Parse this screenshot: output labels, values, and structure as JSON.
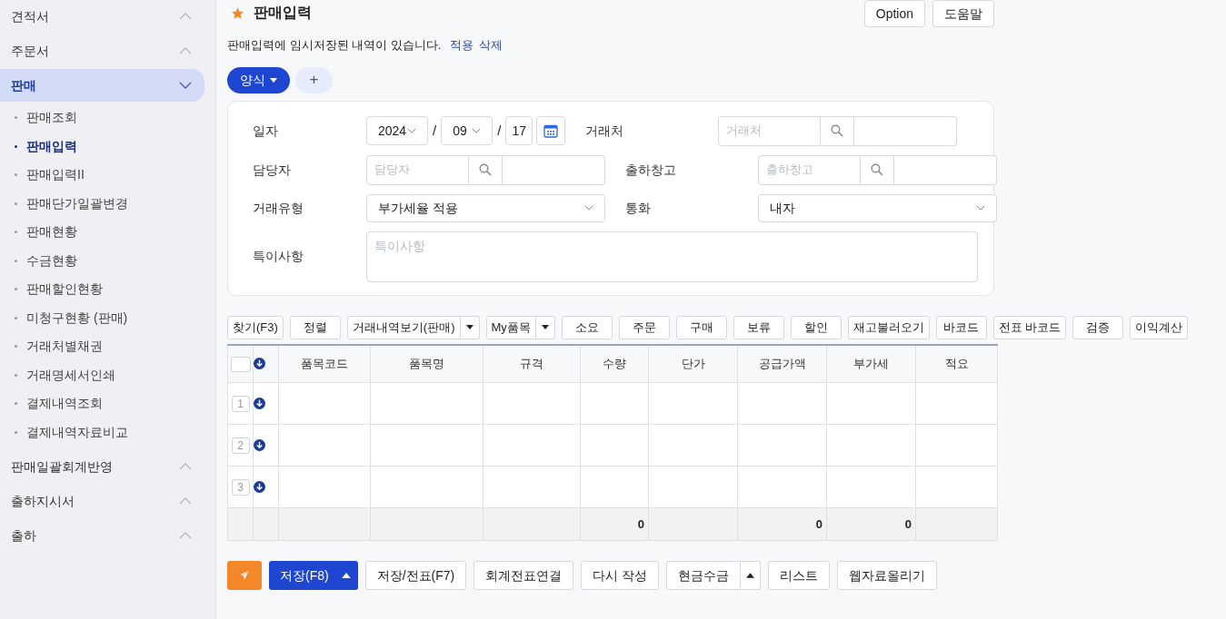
{
  "sidebar": {
    "items": [
      {
        "label": "견적서",
        "expanded": false,
        "selected": false
      },
      {
        "label": "주문서",
        "expanded": false,
        "selected": false
      },
      {
        "label": "판매",
        "expanded": true,
        "selected": true,
        "children": [
          {
            "label": "판매조회",
            "selected": false
          },
          {
            "label": "판매입력",
            "selected": true
          },
          {
            "label": "판매입력II",
            "selected": false
          },
          {
            "label": "판매단가일괄변경",
            "selected": false
          },
          {
            "label": "판매현황",
            "selected": false
          },
          {
            "label": "수금현황",
            "selected": false
          },
          {
            "label": "판매할인현황",
            "selected": false
          },
          {
            "label": "미청구현황 (판매)",
            "selected": false
          },
          {
            "label": "거래처별채권",
            "selected": false
          },
          {
            "label": "거래명세서인쇄",
            "selected": false
          },
          {
            "label": "결제내역조회",
            "selected": false
          },
          {
            "label": "결제내역자료비교",
            "selected": false
          }
        ]
      },
      {
        "label": "판매일괄회계반영",
        "expanded": false,
        "selected": false
      },
      {
        "label": "출하지시서",
        "expanded": false,
        "selected": false
      },
      {
        "label": "출하",
        "expanded": false,
        "selected": false
      }
    ]
  },
  "header": {
    "title": "판매입력",
    "favorite": true,
    "buttons": [
      "Option",
      "도움말"
    ]
  },
  "notice": {
    "text": "판매입력에 임시저장된 내역이 있습니다.",
    "links": [
      "적용",
      "삭제"
    ]
  },
  "tabs": [
    {
      "label": "양식",
      "selected": true
    }
  ],
  "add_tab": "+",
  "form": {
    "rows": [
      [
        {
          "label": "일자",
          "kind": "date",
          "year": "2024",
          "month": "09",
          "day": "17",
          "separator": "/"
        },
        {
          "label": "거래처",
          "kind": "lookup",
          "placeholder": "거래처"
        }
      ],
      [
        {
          "label": "담당자",
          "kind": "lookup",
          "placeholder": "담당자"
        },
        {
          "label": "출하창고",
          "kind": "lookup",
          "placeholder": "출하창고"
        }
      ],
      [
        {
          "label": "거래유형",
          "kind": "select",
          "value": "부가세율 적용"
        },
        {
          "label": "통화",
          "kind": "select",
          "value": "내자"
        }
      ],
      [
        {
          "label": "특이사항",
          "kind": "textarea",
          "placeholder": "특이사항"
        }
      ]
    ]
  },
  "toolbar": [
    {
      "label": "찾기(F3)",
      "kind": "button"
    },
    {
      "label": "정렬",
      "kind": "button"
    },
    {
      "label": "거래내역보기(판매)",
      "kind": "split"
    },
    {
      "label": "My품목",
      "kind": "split"
    },
    {
      "label": "소요",
      "kind": "button"
    },
    {
      "label": "주문",
      "kind": "button"
    },
    {
      "label": "구매",
      "kind": "button"
    },
    {
      "label": "보류",
      "kind": "button"
    },
    {
      "label": "할인",
      "kind": "button"
    },
    {
      "label": "재고불러오기",
      "kind": "button"
    },
    {
      "label": "바코드",
      "kind": "button"
    },
    {
      "label": "전표 바코드",
      "kind": "button"
    },
    {
      "label": "검증",
      "kind": "button"
    },
    {
      "label": "이익계산",
      "kind": "button"
    }
  ],
  "table": {
    "columns": [
      "품목코드",
      "품목명",
      "규격",
      "수량",
      "단가",
      "공급가액",
      "부가세",
      "적요"
    ],
    "select_all_checked": false,
    "rows": [
      {
        "number": "1"
      },
      {
        "number": "2"
      },
      {
        "number": "3"
      }
    ],
    "totals": {
      "quantity": "0",
      "supply_amount": "0",
      "vat": "0"
    }
  },
  "actions": [
    {
      "kind": "send"
    },
    {
      "label": "저장(F8)",
      "kind": "primary-split"
    },
    {
      "label": "저장/전표(F7)",
      "kind": "button"
    },
    {
      "label": "회계전표연결",
      "kind": "button"
    },
    {
      "label": "다시 작성",
      "kind": "button"
    },
    {
      "label": "현금수금",
      "kind": "split"
    },
    {
      "label": "리스트",
      "kind": "button"
    },
    {
      "label": "웹자료올리기",
      "kind": "button"
    }
  ]
}
